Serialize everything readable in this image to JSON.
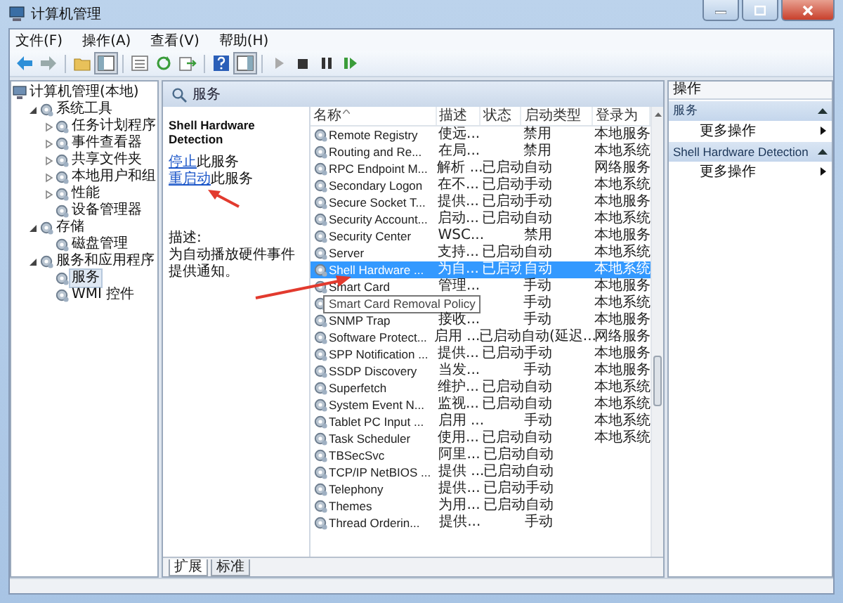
{
  "window": {
    "title": "计算机管理"
  },
  "menu": [
    "文件(F)",
    "操作(A)",
    "查看(V)",
    "帮助(H)"
  ],
  "tree": [
    {
      "label": "计算机管理(本地)",
      "kind": "root",
      "selected": false,
      "children": [
        {
          "label": "系统工具",
          "kind": "branch",
          "expanded": true,
          "selected": false,
          "children": [
            {
              "label": "任务计划程序",
              "kind": "branch",
              "expanded": false,
              "selected": false
            },
            {
              "label": "事件查看器",
              "kind": "branch",
              "expanded": false,
              "selected": false
            },
            {
              "label": "共享文件夹",
              "kind": "branch",
              "expanded": false,
              "selected": false
            },
            {
              "label": "本地用户和组",
              "kind": "branch",
              "expanded": false,
              "selected": false
            },
            {
              "label": "性能",
              "kind": "branch",
              "expanded": false,
              "selected": false
            },
            {
              "label": "设备管理器",
              "kind": "leaf",
              "selected": false
            }
          ]
        },
        {
          "label": "存储",
          "kind": "branch",
          "expanded": true,
          "selected": false,
          "children": [
            {
              "label": "磁盘管理",
              "kind": "leaf",
              "selected": false
            }
          ]
        },
        {
          "label": "服务和应用程序",
          "kind": "branch",
          "expanded": true,
          "selected": false,
          "children": [
            {
              "label": "服务",
              "kind": "leaf",
              "selected": true
            },
            {
              "label": "WMI 控件",
              "kind": "leaf",
              "selected": false
            }
          ]
        }
      ]
    }
  ],
  "center": {
    "heading": "服务",
    "detail": {
      "title": "Shell Hardware Detection",
      "actions": [
        {
          "link": "停止",
          "text": "此服务"
        },
        {
          "link": "重启动",
          "text": "此服务"
        }
      ],
      "description_label": "描述:",
      "description": "为自动播放硬件事件提供通知。"
    },
    "table": {
      "columns": [
        {
          "label": "名称",
          "sorted": true
        },
        {
          "label": "描述",
          "sorted": false
        },
        {
          "label": "状态",
          "sorted": false
        },
        {
          "label": "启动类型",
          "sorted": false
        },
        {
          "label": "登录为",
          "sorted": false
        }
      ],
      "rows": [
        {
          "name": "Remote Registry",
          "description": "使远...",
          "startup": "禁用",
          "login": "本地服务",
          "selected": false
        },
        {
          "name": "Routing and Re...",
          "description": "在局...",
          "startup": "禁用",
          "login": "本地系统",
          "selected": false
        },
        {
          "name": "RPC Endpoint M...",
          "description": "解析 ...",
          "status": "已启动",
          "startup": "自动",
          "login": "网络服务",
          "selected": false
        },
        {
          "name": "Secondary Logon",
          "description": "在不...",
          "status": "已启动",
          "startup": "手动",
          "login": "本地系统",
          "selected": false
        },
        {
          "name": "Secure Socket T...",
          "description": "提供...",
          "status": "已启动",
          "startup": "手动",
          "login": "本地服务",
          "selected": false
        },
        {
          "name": "Security Account...",
          "description": "启动...",
          "status": "已启动",
          "startup": "自动",
          "login": "本地系统",
          "selected": false
        },
        {
          "name": "Security Center",
          "description": "WSC...",
          "startup": "禁用",
          "login": "本地服务",
          "selected": false
        },
        {
          "name": "Server",
          "description": "支持...",
          "status": "已启动",
          "startup": "自动",
          "login": "本地系统",
          "selected": false
        },
        {
          "name": "Shell Hardware ...",
          "description": "为自...",
          "status": "已启动",
          "startup": "自动",
          "login": "本地系统",
          "selected": true
        },
        {
          "name": "Smart Card",
          "description": "管理...",
          "startup": "手动",
          "login": "本地服务",
          "selected": false
        },
        {
          "tooltip": "Smart Card Removal Policy",
          "startup": "手动",
          "login": "本地系统",
          "selected": false
        },
        {
          "name": "SNMP Trap",
          "description": "接收...",
          "startup": "手动",
          "login": "本地服务",
          "selected": false
        },
        {
          "name": "Software Protect...",
          "description": "启用 ...",
          "status": "已启动",
          "startup": "自动(延迟...",
          "login": "网络服务",
          "selected": false
        },
        {
          "name": "SPP Notification ...",
          "description": "提供...",
          "status": "已启动",
          "startup": "手动",
          "login": "本地服务",
          "selected": false
        },
        {
          "name": "SSDP Discovery",
          "description": "当发...",
          "startup": "手动",
          "login": "本地服务",
          "selected": false
        },
        {
          "name": "Superfetch",
          "description": "维护...",
          "status": "已启动",
          "startup": "自动",
          "login": "本地系统",
          "selected": false
        },
        {
          "name": "System Event N...",
          "description": "监视...",
          "status": "已启动",
          "startup": "自动",
          "login": "本地系统",
          "selected": false
        },
        {
          "name": "Tablet PC Input ...",
          "description": "启用 ...",
          "startup": "手动",
          "login": "本地系统",
          "selected": false
        },
        {
          "name": "Task Scheduler",
          "description": "使用...",
          "status": "已启动",
          "startup": "自动",
          "login": "本地系统",
          "selected": false
        },
        {
          "name": "TBSecSvc",
          "description": "阿里...",
          "status": "已启动",
          "startup": "自动",
          "selected": false
        },
        {
          "name": "TCP/IP NetBIOS ...",
          "description": "提供 ...",
          "status": "已启动",
          "startup": "自动",
          "selected": false
        },
        {
          "name": "Telephony",
          "description": "提供...",
          "status": "已启动",
          "startup": "手动",
          "selected": false
        },
        {
          "name": "Themes",
          "description": "为用...",
          "status": "已启动",
          "startup": "自动",
          "selected": false
        },
        {
          "name": "Thread Orderin...",
          "description": "提供...",
          "startup": "手动",
          "selected": false
        }
      ]
    },
    "view_tabs": [
      {
        "label": "扩展",
        "selected": true
      },
      {
        "label": "标准",
        "selected": false
      }
    ]
  },
  "actions_pane": {
    "header": "操作",
    "sections": [
      {
        "title": "服务",
        "expanded": true,
        "items": [
          "更多操作"
        ]
      },
      {
        "title": "Shell Hardware Detection",
        "expanded": true,
        "items": [
          "更多操作"
        ]
      }
    ]
  }
}
